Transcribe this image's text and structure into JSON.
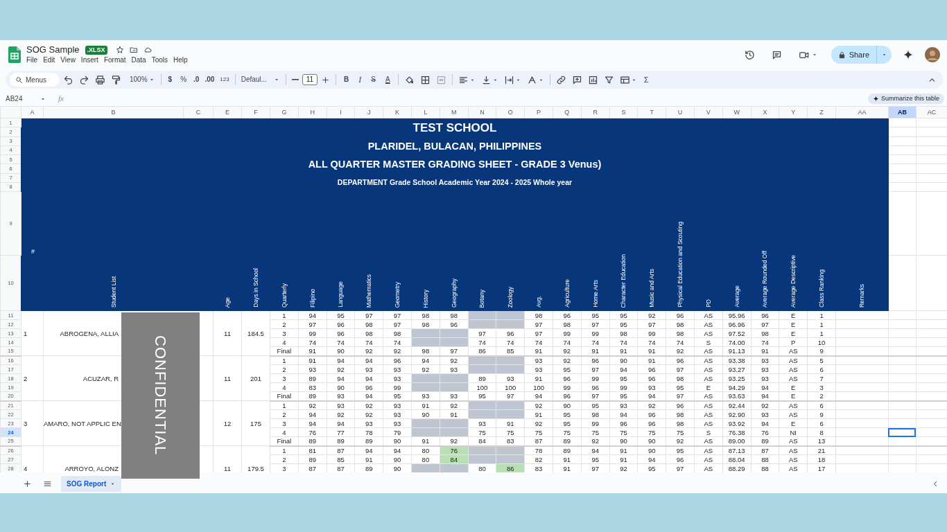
{
  "app": {
    "title": "SOG Sample",
    "badge": ".XLSX",
    "menus": [
      "File",
      "Edit",
      "View",
      "Insert",
      "Format",
      "Data",
      "Tools",
      "Help"
    ],
    "share": "Share"
  },
  "toolbar": {
    "search": "Menus",
    "zoom": "100%",
    "currency": "$",
    "percent": "%",
    "decrease_decimals": ".0",
    "increase_decimals": ".00",
    "number_format": "123",
    "font": "Defaul...",
    "font_size": "11",
    "bold": "B",
    "italic": "I",
    "strikethrough": "S",
    "text_color": "A",
    "functions": "Σ"
  },
  "formula_bar": {
    "name_box": "AB24",
    "fx": "fx",
    "summarize": "Summarize this table"
  },
  "columns": [
    {
      "label": "A",
      "selected": false
    },
    {
      "label": "B",
      "selected": false
    },
    {
      "label": "C",
      "selected": false
    },
    {
      "label": "E",
      "selected": false
    },
    {
      "label": "F",
      "selected": false
    },
    {
      "label": "G",
      "selected": false
    },
    {
      "label": "H",
      "selected": false
    },
    {
      "label": "I",
      "selected": false
    },
    {
      "label": "J",
      "selected": false
    },
    {
      "label": "K",
      "selected": false
    },
    {
      "label": "L",
      "selected": false
    },
    {
      "label": "M",
      "selected": false
    },
    {
      "label": "N",
      "selected": false
    },
    {
      "label": "O",
      "selected": false
    },
    {
      "label": "P",
      "selected": false
    },
    {
      "label": "Q",
      "selected": false
    },
    {
      "label": "R",
      "selected": false
    },
    {
      "label": "S",
      "selected": false
    },
    {
      "label": "T",
      "selected": false
    },
    {
      "label": "U",
      "selected": false
    },
    {
      "label": "V",
      "selected": false
    },
    {
      "label": "W",
      "selected": false
    },
    {
      "label": "X",
      "selected": false
    },
    {
      "label": "Y",
      "selected": false
    },
    {
      "label": "Z",
      "selected": false
    },
    {
      "label": "AA",
      "selected": false
    },
    {
      "label": "AB",
      "selected": true
    },
    {
      "label": "AC",
      "selected": false
    }
  ],
  "row_numbers": [
    {
      "label": "1",
      "selected": false
    },
    {
      "label": "2",
      "selected": false
    },
    {
      "label": "3",
      "selected": false
    },
    {
      "label": "4",
      "selected": false
    },
    {
      "label": "5",
      "selected": false
    },
    {
      "label": "6",
      "selected": false
    },
    {
      "label": "7",
      "selected": false
    },
    {
      "label": "8",
      "selected": false
    },
    {
      "label": "9",
      "selected": false
    },
    {
      "label": "10",
      "selected": false
    },
    {
      "label": "11",
      "selected": false
    },
    {
      "label": "12",
      "selected": false
    },
    {
      "label": "13",
      "selected": false
    },
    {
      "label": "14",
      "selected": false
    },
    {
      "label": "15",
      "selected": false
    },
    {
      "label": "16",
      "selected": false
    },
    {
      "label": "17",
      "selected": false
    },
    {
      "label": "18",
      "selected": false
    },
    {
      "label": "19",
      "selected": false
    },
    {
      "label": "20",
      "selected": false
    },
    {
      "label": "21",
      "selected": false
    },
    {
      "label": "22",
      "selected": false
    },
    {
      "label": "23",
      "selected": false
    },
    {
      "label": "24",
      "selected": true
    },
    {
      "label": "25",
      "selected": false
    },
    {
      "label": "26",
      "selected": false
    },
    {
      "label": "27",
      "selected": false
    },
    {
      "label": "28",
      "selected": false
    }
  ],
  "header": {
    "titles": [
      "TEST SCHOOL",
      "PLARIDEL, BULACAN, PHILIPPINES",
      "ALL QUARTER MASTER GRADING SHEET - GRADE 3 Venus)",
      "DEPARTMENT Grade School Academic Year 2024 - 2025 Whole year"
    ],
    "number_label": "#",
    "headings": [
      "Student List",
      "Age",
      "Days in School",
      "Quarterly",
      "Filipino",
      "Language",
      "Mathematics",
      "Geometry",
      "History",
      "Geography",
      "Botany",
      "Zoology",
      "Avg.",
      "Agriculture",
      "Home Arts",
      "Character Education",
      "Music and Arts",
      "Physical Education and Scouting",
      "PD",
      "Average",
      "Average Rounded Off",
      "Average Descriptive",
      "Class Ranking",
      "Remarks"
    ]
  },
  "students": [
    {
      "number": "1",
      "name": "ABROGENA,  ALLIA",
      "age": "11",
      "days": "184.5",
      "rows": [
        [
          "1",
          "94",
          "95",
          "97",
          "97",
          "98",
          "98",
          {
            "color": "#bfc5d1"
          },
          {
            "color": "#bfc5d1"
          },
          "98",
          "96",
          "95",
          "95",
          "92",
          "96",
          "AS",
          "95.96",
          "96",
          "E",
          "1"
        ],
        [
          "2",
          "97",
          "96",
          "98",
          "97",
          "98",
          "96",
          {
            "color": "#bfc5d1"
          },
          {
            "color": "#bfc5d1"
          },
          "97",
          "98",
          "97",
          "95",
          "97",
          "98",
          "AS",
          "96.96",
          "97",
          "E",
          "1"
        ],
        [
          "3",
          "99",
          "96",
          "98",
          "98",
          {
            "color": "#bfc5d1"
          },
          {
            "color": "#bfc5d1"
          },
          "97",
          "96",
          "97",
          "99",
          "99",
          "98",
          "99",
          "98",
          "AS",
          "97.52",
          "98",
          "E",
          "1"
        ],
        [
          "4",
          "74",
          "74",
          "74",
          "74",
          {
            "color": "#bfc5d1"
          },
          {
            "color": "#bfc5d1"
          },
          "74",
          "74",
          "74",
          "74",
          "74",
          "74",
          "74",
          "74",
          "S",
          "74.00",
          "74",
          "P",
          "10"
        ],
        [
          "Final",
          "91",
          "90",
          "92",
          "92",
          "98",
          "97",
          "86",
          "85",
          "91",
          "92",
          "91",
          "91",
          "91",
          "92",
          "AS",
          "91.13",
          "91",
          "AS",
          "9"
        ]
      ]
    },
    {
      "number": "2",
      "name": "ACUZAR,  R",
      "age": "11",
      "days": "201",
      "rows": [
        [
          "1",
          "91",
          "94",
          "94",
          "96",
          "94",
          "92",
          {
            "color": "#bfc5d1"
          },
          {
            "color": "#bfc5d1"
          },
          "93",
          "92",
          "96",
          "90",
          "91",
          "96",
          "AS",
          "93.38",
          "93",
          "AS",
          "5"
        ],
        [
          "2",
          "93",
          "92",
          "93",
          "93",
          "92",
          "93",
          {
            "color": "#bfc5d1"
          },
          {
            "color": "#bfc5d1"
          },
          "93",
          "95",
          "97",
          "94",
          "96",
          "97",
          "AS",
          "93.27",
          "93",
          "AS",
          "6"
        ],
        [
          "3",
          "89",
          "94",
          "94",
          "93",
          {
            "color": "#bfc5d1"
          },
          {
            "color": "#bfc5d1"
          },
          "89",
          "93",
          "91",
          "96",
          "99",
          "95",
          "96",
          "98",
          "AS",
          "93.25",
          "93",
          "AS",
          "7"
        ],
        [
          "4",
          "83",
          "90",
          "96",
          "99",
          {
            "color": "#bfc5d1"
          },
          {
            "color": "#bfc5d1"
          },
          "100",
          "100",
          "100",
          "99",
          "96",
          "99",
          "93",
          "95",
          "E",
          "94.29",
          "94",
          "E",
          "3"
        ],
        [
          "Final",
          "89",
          "93",
          "94",
          "95",
          "93",
          "93",
          "95",
          "97",
          "94",
          "96",
          "97",
          "95",
          "94",
          "97",
          "AS",
          "93.63",
          "94",
          "E",
          "2"
        ]
      ]
    },
    {
      "number": "3",
      "name": "AMARO, NOT APPLIC EN",
      "age": "12",
      "days": "175",
      "rows": [
        [
          "1",
          "92",
          "93",
          "92",
          "93",
          "91",
          "92",
          {
            "color": "#bfc5d1"
          },
          {
            "color": "#bfc5d1"
          },
          "92",
          "90",
          "95",
          "93",
          "92",
          "96",
          "AS",
          "92.44",
          "92",
          "AS",
          "6"
        ],
        [
          "2",
          "94",
          "92",
          "92",
          "93",
          "90",
          "91",
          {
            "color": "#bfc5d1"
          },
          {
            "color": "#bfc5d1"
          },
          "91",
          "95",
          "98",
          "94",
          "96",
          "98",
          "AS",
          "92.90",
          "93",
          "AS",
          "9"
        ],
        [
          "3",
          "94",
          "94",
          "93",
          "93",
          {
            "color": "#bfc5d1"
          },
          {
            "color": "#bfc5d1"
          },
          "93",
          "91",
          "92",
          "95",
          "99",
          "96",
          "96",
          "98",
          "AS",
          "93.92",
          "94",
          "E",
          "6"
        ],
        [
          "4",
          "76",
          "77",
          "78",
          "79",
          {
            "color": "#bfc5d1"
          },
          {
            "color": "#bfc5d1"
          },
          "75",
          "75",
          "75",
          "75",
          "75",
          "75",
          "75",
          "75",
          "S",
          "76.38",
          "76",
          "NI",
          "8"
        ],
        [
          "Final",
          "89",
          "89",
          "89",
          "90",
          "91",
          "92",
          "84",
          "83",
          "87",
          "89",
          "92",
          "90",
          "90",
          "92",
          "AS",
          "89.00",
          "89",
          "AS",
          "13"
        ]
      ]
    },
    {
      "number": "4",
      "name": "ARROYO,  ALONZ",
      "age": "11",
      "days": "179.5",
      "rows": [
        [
          "1",
          "81",
          "87",
          "94",
          "94",
          "80",
          {
            "text": "76",
            "color": "#b7e1b0"
          },
          {
            "color": "#bfc5d1"
          },
          {
            "color": "#bfc5d1"
          },
          "78",
          "89",
          "94",
          "91",
          "90",
          "95",
          "AS",
          "87.13",
          "87",
          "AS",
          "21"
        ],
        [
          "2",
          "89",
          "85",
          "91",
          "90",
          "80",
          {
            "text": "84",
            "color": "#b7e1b0"
          },
          {
            "color": "#bfc5d1"
          },
          {
            "color": "#bfc5d1"
          },
          "82",
          "91",
          "95",
          "91",
          "94",
          "96",
          "AS",
          "88.04",
          "88",
          "AS",
          "18"
        ],
        [
          "3",
          "87",
          "87",
          "89",
          "90",
          {
            "color": "#bfc5d1"
          },
          {
            "color": "#bfc5d1"
          },
          "80",
          {
            "text": "86",
            "color": "#b7e1b0"
          },
          "83",
          "91",
          "97",
          "92",
          "95",
          "97",
          "AS",
          "88.29",
          "88",
          "AS",
          "17"
        ]
      ]
    }
  ],
  "redaction": {
    "text": "CONFIDENTIAL"
  },
  "sheet_tabs": [
    {
      "label": "SOG Report",
      "selected": true
    }
  ]
}
